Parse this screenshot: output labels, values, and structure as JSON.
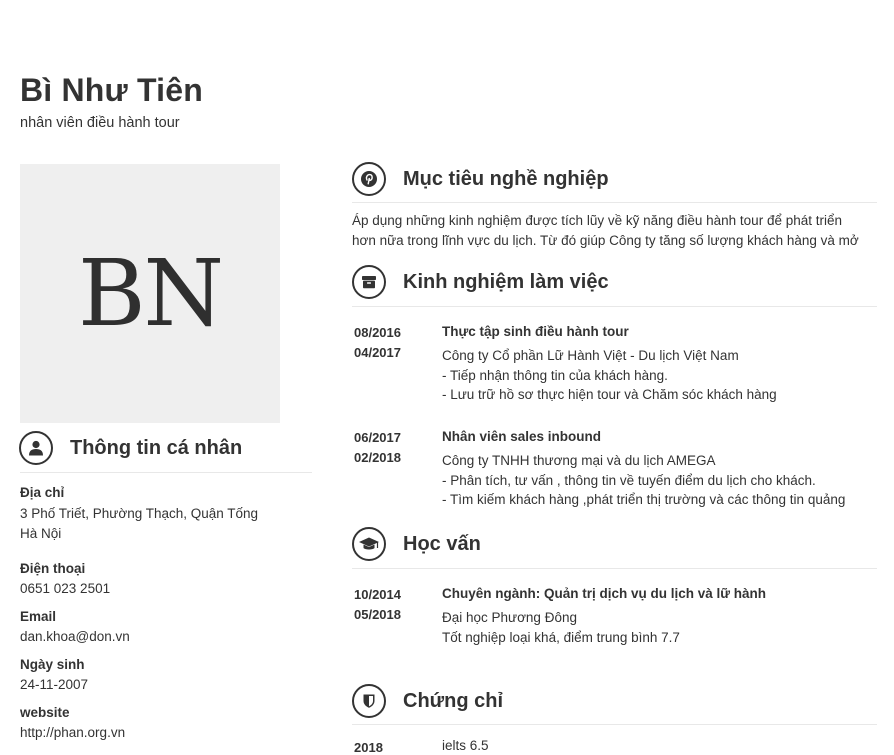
{
  "profile": {
    "name": "Bì Như Tiên",
    "job_title": "nhân viên điều hành tour",
    "avatar_initials": "BN"
  },
  "personal": {
    "title": "Thông tin cá nhân",
    "icon": "user-icon",
    "address_label": "Địa chỉ",
    "address_line1": "3 Phố Triết, Phường Thạch, Quận Tống",
    "address_line2": "Hà Nội",
    "phone_label": "Điện thoại",
    "phone": "0651 023 2501",
    "email_label": "Email",
    "email": "dan.khoa@don.vn",
    "birth_label": "Ngày sinh",
    "birth": "24-11-2007",
    "website_label": "website",
    "website": "http://phan.org.vn"
  },
  "objective": {
    "title": "Mục tiêu nghề nghiệp",
    "icon": "pinterest-icon",
    "line1": "Áp dụng những kinh nghiệm được tích lũy về kỹ năng điều hành tour để phát triển",
    "line2": "hơn nữa trong lĩnh vực du lịch. Từ đó giúp Công ty tăng số lượng khách hàng và mở"
  },
  "experience": {
    "title": "Kinh nghiệm làm việc",
    "icon": "archive-icon",
    "items": [
      {
        "start": "08/2016",
        "end": "04/2017",
        "position": "Thực tập sinh điều hành tour",
        "company": "Công ty Cổ phần Lữ Hành Việt -  Du lịch Việt Nam",
        "duty1": "- Tiếp nhận thông tin của khách hàng.",
        "duty2": "- Lưu trữ hồ sơ thực hiện tour và Chăm sóc khách hàng"
      },
      {
        "start": "06/2017",
        "end": "02/2018",
        "position": "Nhân viên sales inbound",
        "company": "Công ty TNHH thương mại và du lịch AMEGA",
        "duty1": "- Phân tích, tư vấn , thông tin về tuyến điểm du lịch cho khách.",
        "duty2": "- Tìm kiếm khách hàng ,phát triển thị trường và các thông tin quảng"
      }
    ]
  },
  "education": {
    "title": "Học vấn",
    "icon": "graduation-cap-icon",
    "start": "10/2014",
    "end": "05/2018",
    "major": "Chuyên ngành: Quản trị dịch vụ du lịch và lữ hành",
    "school": "Đại học Phương Đông",
    "result": "Tốt nghiệp loại khá, điểm trung bình 7.7"
  },
  "certificates": {
    "title": "Chứng chỉ",
    "icon": "shield-icon",
    "year": "2018",
    "name": "ielts 6.5"
  }
}
